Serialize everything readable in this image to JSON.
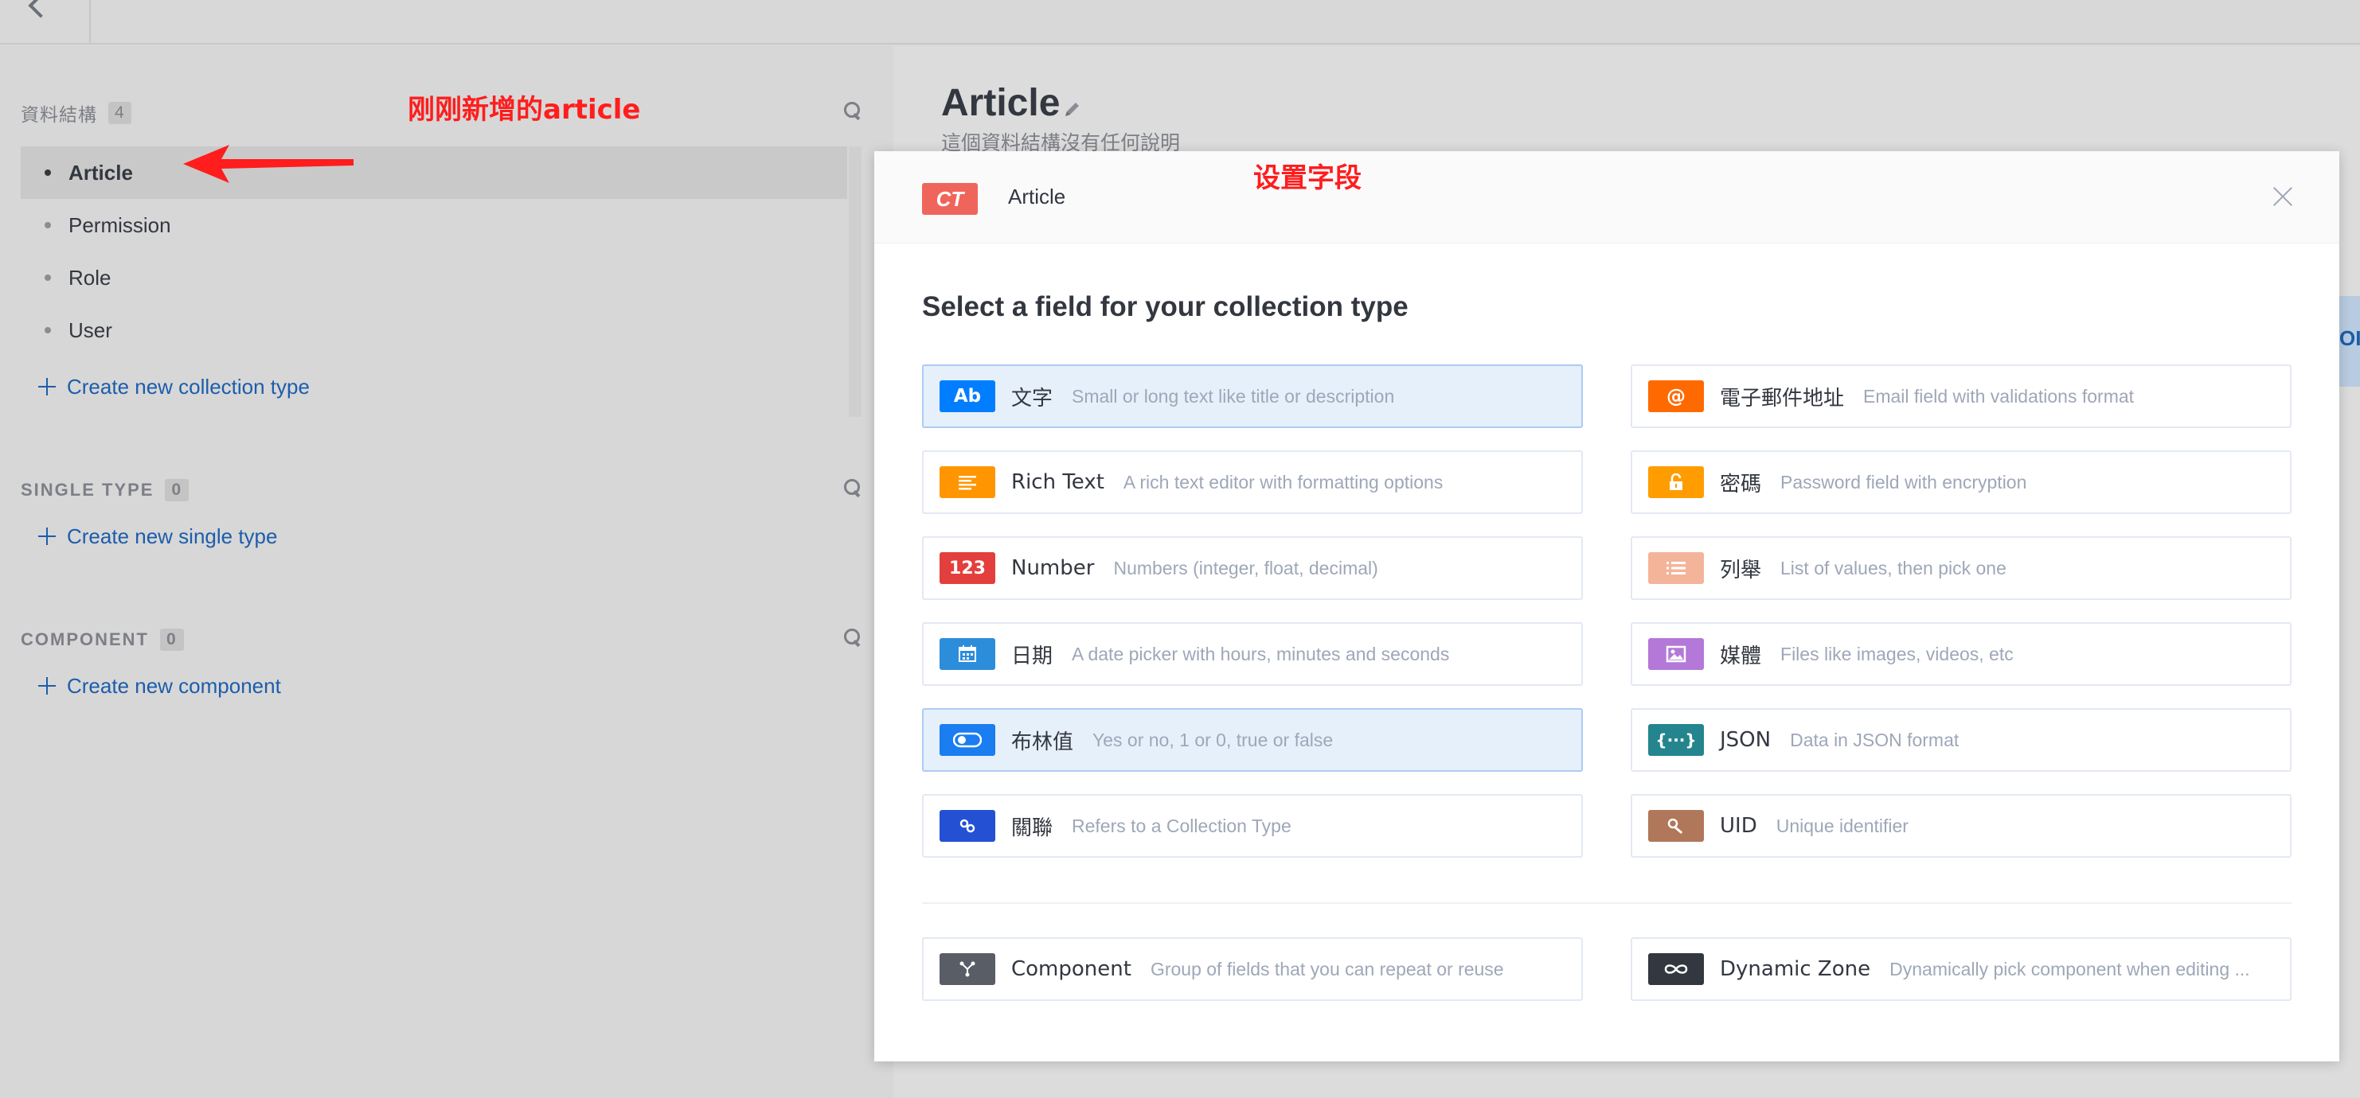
{
  "sidebar": {
    "collection_header": "資料結構",
    "collection_count": "4",
    "collection_items": [
      {
        "label": "Article"
      },
      {
        "label": "Permission"
      },
      {
        "label": "Role"
      },
      {
        "label": "User"
      }
    ],
    "create_collection": "Create new collection type",
    "single_header": "SINGLE TYPE",
    "single_count": "0",
    "create_single": "Create new single type",
    "component_header": "COMPONENT",
    "component_count": "0",
    "create_component": "Create new component"
  },
  "annotations": {
    "left_note": "刚刚新增的article",
    "right_note": "设置字段",
    "color": "#ff1d1d"
  },
  "main": {
    "title": "Article",
    "description": "這個資料結構沒有任何說明",
    "side_tab": "OI"
  },
  "modal": {
    "badge": "CT",
    "collection_name": "Article",
    "subtitle": "Select a field for your collection type",
    "fields_left": [
      {
        "icon": "Ab",
        "icon_name": "text-icon",
        "color": "#007eff",
        "name": "文字",
        "desc": "Small or long text like title or description",
        "highlight": true
      },
      {
        "icon": "≡",
        "icon_name": "rich-text-icon",
        "color": "#ff9500",
        "name": "Rich Text",
        "desc": "A rich text editor with formatting options",
        "highlight": false
      },
      {
        "icon": "123",
        "icon_name": "number-icon",
        "color": "#e33f3c",
        "name": "Number",
        "desc": "Numbers (integer, float, decimal)",
        "highlight": false
      },
      {
        "icon": "▦",
        "icon_name": "calendar-icon",
        "color": "#2c8ddb",
        "name": "日期",
        "desc": "A date picker with hours, minutes and seconds",
        "highlight": false
      },
      {
        "icon": "toggle",
        "icon_name": "toggle-icon",
        "color": "#1a7df0",
        "name": "布林值",
        "desc": "Yes or no, 1 or 0, true or false",
        "highlight": true
      },
      {
        "icon": "⚯",
        "icon_name": "link-icon",
        "color": "#2450d3",
        "name": "關聯",
        "desc": "Refers to a Collection Type",
        "highlight": false
      }
    ],
    "fields_right": [
      {
        "icon": "@",
        "icon_name": "email-icon",
        "color": "#ff6a00",
        "name": "電子郵件地址",
        "desc": "Email field with validations format"
      },
      {
        "icon": "🔓",
        "icon_name": "lock-icon",
        "color": "#ff9c00",
        "name": "密碼",
        "desc": "Password field with encryption"
      },
      {
        "icon": "☰",
        "icon_name": "list-icon",
        "color": "#f4b49a",
        "name": "列舉",
        "desc": "List of values, then pick one"
      },
      {
        "icon": "▨",
        "icon_name": "image-icon",
        "color": "#b478d8",
        "name": "媒體",
        "desc": "Files like images, videos, etc"
      },
      {
        "icon": "{···}",
        "icon_name": "json-icon",
        "color": "#24858e",
        "name": "JSON",
        "desc": "Data in JSON format"
      },
      {
        "icon": "🔑",
        "icon_name": "key-icon",
        "color": "#b0775a",
        "name": "UID",
        "desc": "Unique identifier"
      }
    ],
    "bottom_left": {
      "icon": "⑂",
      "icon_name": "component-icon",
      "color": "#595d66",
      "name": "Component",
      "desc": "Group of fields that you can repeat or reuse"
    },
    "bottom_right": {
      "icon": "∞",
      "icon_name": "infinity-icon",
      "color": "#333740",
      "name": "Dynamic Zone",
      "desc": "Dynamically pick component when editing ..."
    }
  }
}
